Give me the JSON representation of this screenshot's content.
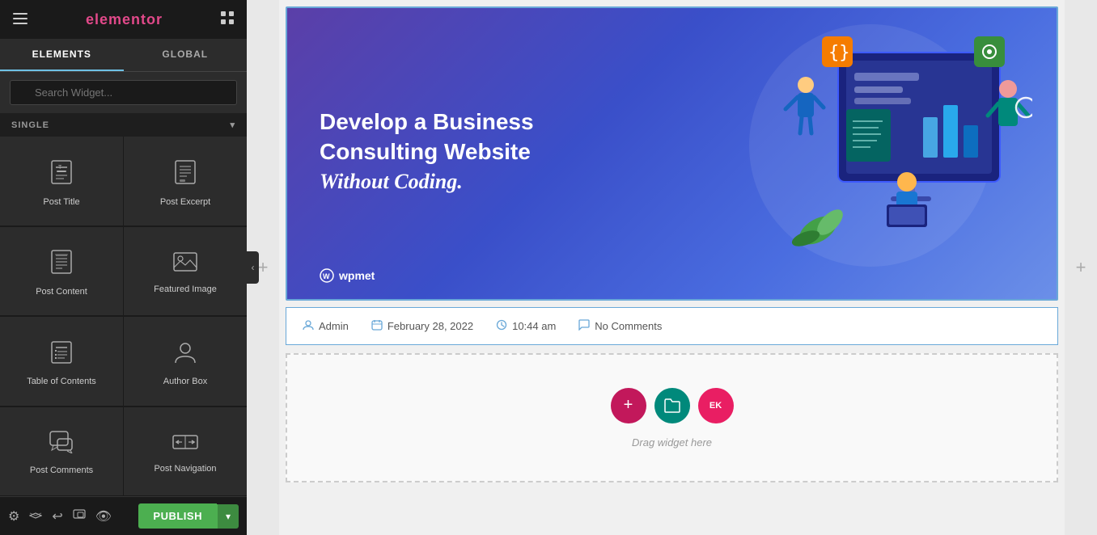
{
  "topbar": {
    "logo": "elementor",
    "hamburger": "☰",
    "grid": "⠿"
  },
  "tabs": [
    {
      "id": "elements",
      "label": "ELEMENTS",
      "active": true
    },
    {
      "id": "global",
      "label": "GLOBAL",
      "active": false
    }
  ],
  "search": {
    "placeholder": "Search Widget..."
  },
  "section": {
    "label": "SINGLE",
    "collapse_icon": "▾"
  },
  "widgets": [
    {
      "id": "post-title",
      "label": "Post Title",
      "icon": "📄"
    },
    {
      "id": "post-excerpt",
      "label": "Post Excerpt",
      "icon": "📋"
    },
    {
      "id": "post-content",
      "label": "Post Content",
      "icon": "📝"
    },
    {
      "id": "featured-image",
      "label": "Featured Image",
      "icon": "🖼"
    },
    {
      "id": "table-of-contents",
      "label": "Table of Contents",
      "icon": "☰"
    },
    {
      "id": "author-box",
      "label": "Author Box",
      "icon": "👤"
    },
    {
      "id": "post-comments",
      "label": "Post Comments",
      "icon": "💬"
    },
    {
      "id": "post-navigation",
      "label": "Post Navigation",
      "icon": "⇔"
    }
  ],
  "bottombar": {
    "icons": [
      "⚙",
      "⊕",
      "↩",
      "📱",
      "👁"
    ],
    "publish_label": "PUBLISH",
    "arrow": "▾"
  },
  "canvas": {
    "add_col_left": "+",
    "add_col_right": "+",
    "featured_image": {
      "headline_line1": "Develop a Business",
      "headline_line2": "Consulting Website",
      "headline_line3": "Without Coding.",
      "logo_text": "wpmet"
    },
    "post_meta": {
      "author_icon": "👤",
      "author": "Admin",
      "date_icon": "📅",
      "date": "February 28, 2022",
      "time_icon": "🕐",
      "time": "10:44 am",
      "comments_icon": "💬",
      "comments": "No Comments"
    },
    "drag_hint": "Drag widget here",
    "action_buttons": [
      {
        "id": "plus",
        "icon": "+",
        "class": "btn-plus"
      },
      {
        "id": "folder",
        "icon": "🗁",
        "class": "btn-folder"
      },
      {
        "id": "ek",
        "icon": "EK",
        "class": "btn-ek"
      }
    ]
  },
  "colors": {
    "accent_blue": "#6ec1e4",
    "accent_green": "#4CAF50",
    "dark_bg": "#1a1a1a",
    "panel_bg": "#2c2c2c"
  }
}
